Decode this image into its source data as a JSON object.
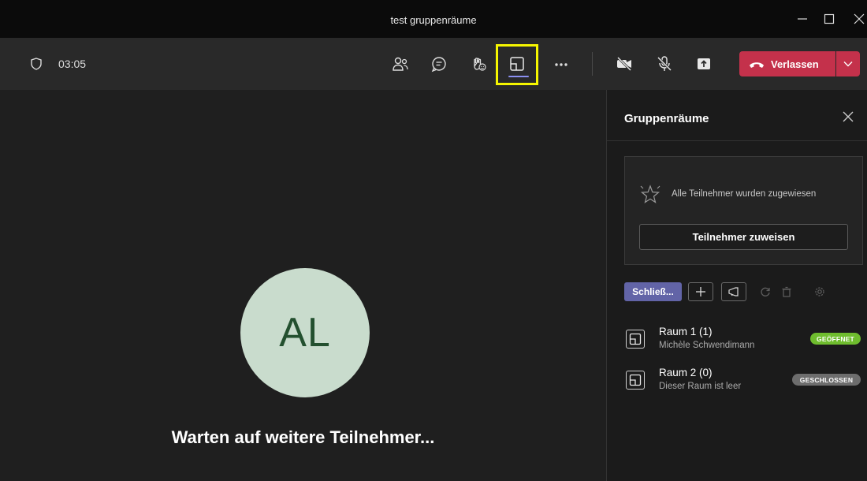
{
  "window": {
    "title": "test gruppenräume"
  },
  "toolbar": {
    "timer": "03:05",
    "leave_label": "Verlassen",
    "icons": [
      "shield-icon",
      "participants-icon",
      "chat-icon",
      "raise-hand-icon",
      "breakout-rooms-icon",
      "more-icon",
      "camera-off-icon",
      "mic-off-icon",
      "share-icon",
      "phone-icon",
      "chevron-down-icon"
    ]
  },
  "stage": {
    "avatar_initials": "AL",
    "waiting_text": "Warten auf weitere Teilnehmer..."
  },
  "panel": {
    "title": "Gruppenräume",
    "assign_status": "Alle Teilnehmer wurden zugewiesen",
    "assign_button": "Teilnehmer zuweisen",
    "close_rooms_button": "Schließ...",
    "rooms": [
      {
        "name": "Raum 1 (1)",
        "subtitle": "Michèle Schwendimann",
        "status": "GEÖFFNET"
      },
      {
        "name": "Raum 2 (0)",
        "subtitle": "Dieser Raum ist leer",
        "status": "GESCHLOSSEN"
      }
    ]
  },
  "colors": {
    "accent": "#6264a7",
    "leave": "#c4314b",
    "highlight": "#f5f500",
    "open_badge": "#6fbd2e",
    "closed_badge": "#6d6d6d"
  }
}
